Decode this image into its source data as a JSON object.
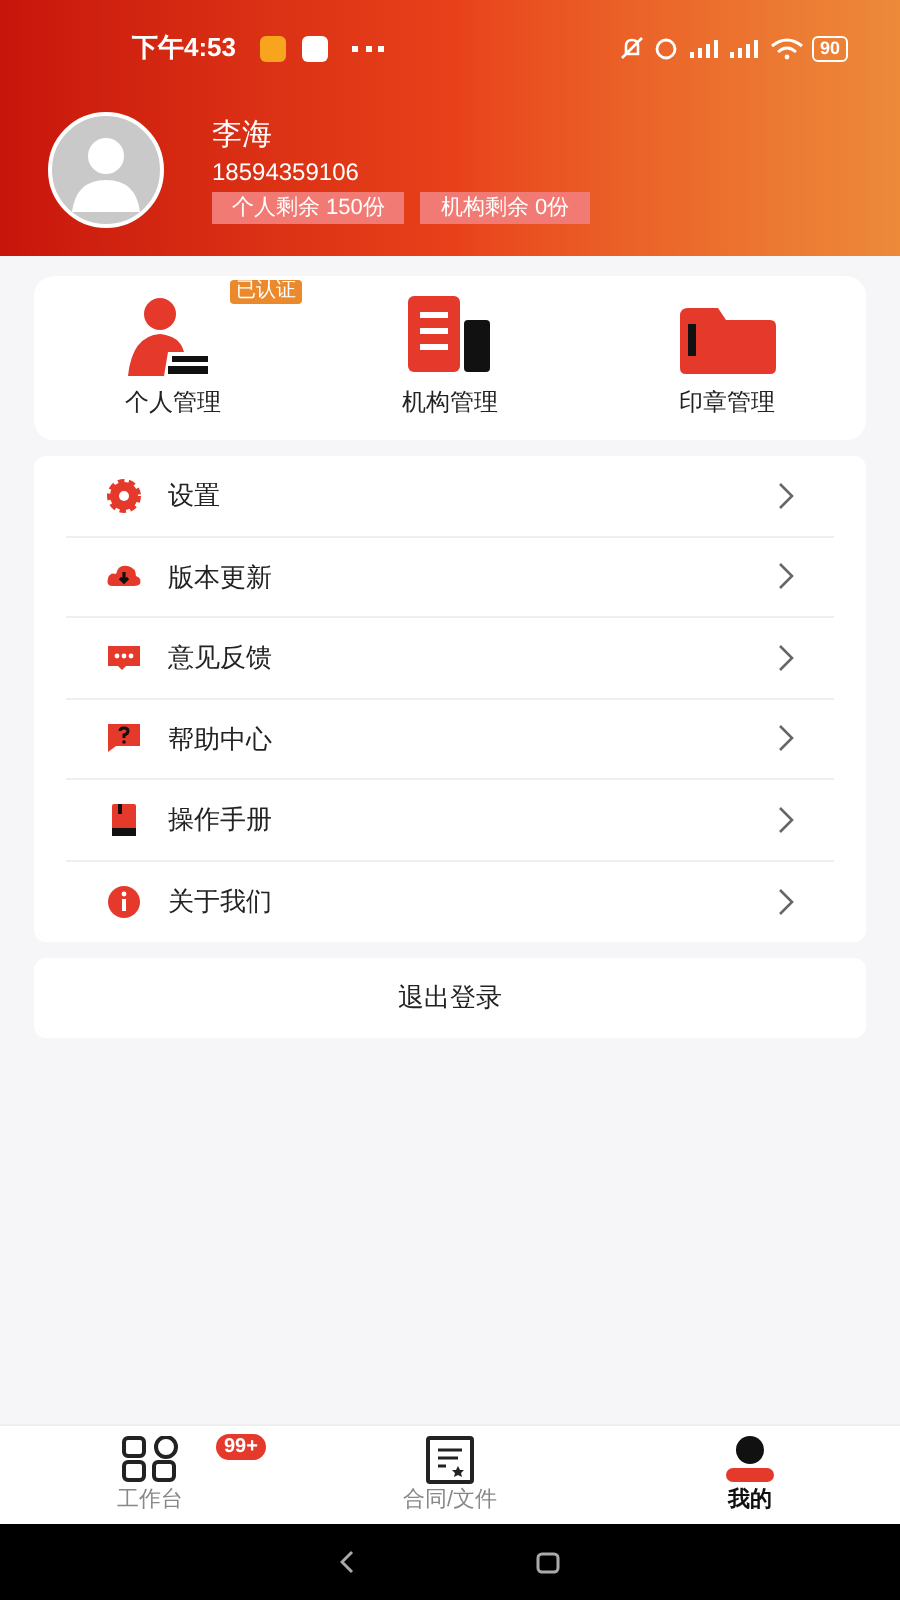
{
  "status_bar": {
    "time": "下午4:53",
    "battery": "90"
  },
  "profile": {
    "name": "李海",
    "phone": "18594359106",
    "quotas": [
      "个人剩余 150份",
      "机构剩余 0份"
    ]
  },
  "shortcuts": [
    {
      "kind": "person",
      "label": "个人管理",
      "badge": "已认证"
    },
    {
      "kind": "org",
      "label": "机构管理"
    },
    {
      "kind": "seal",
      "label": "印章管理"
    }
  ],
  "menu": [
    {
      "kind": "settings",
      "label": "设置"
    },
    {
      "kind": "update",
      "label": "版本更新"
    },
    {
      "kind": "feedback",
      "label": "意见反馈"
    },
    {
      "kind": "help",
      "label": "帮助中心"
    },
    {
      "kind": "manual",
      "label": "操作手册"
    },
    {
      "kind": "about",
      "label": "关于我们"
    }
  ],
  "logout": "退出登录",
  "tab_bar": [
    {
      "kind": "workbench",
      "label": "工作台",
      "badge": "99+",
      "selected": false
    },
    {
      "kind": "contract",
      "label": "合同/文件",
      "selected": false
    },
    {
      "kind": "me",
      "label": "我的",
      "selected": true
    }
  ]
}
